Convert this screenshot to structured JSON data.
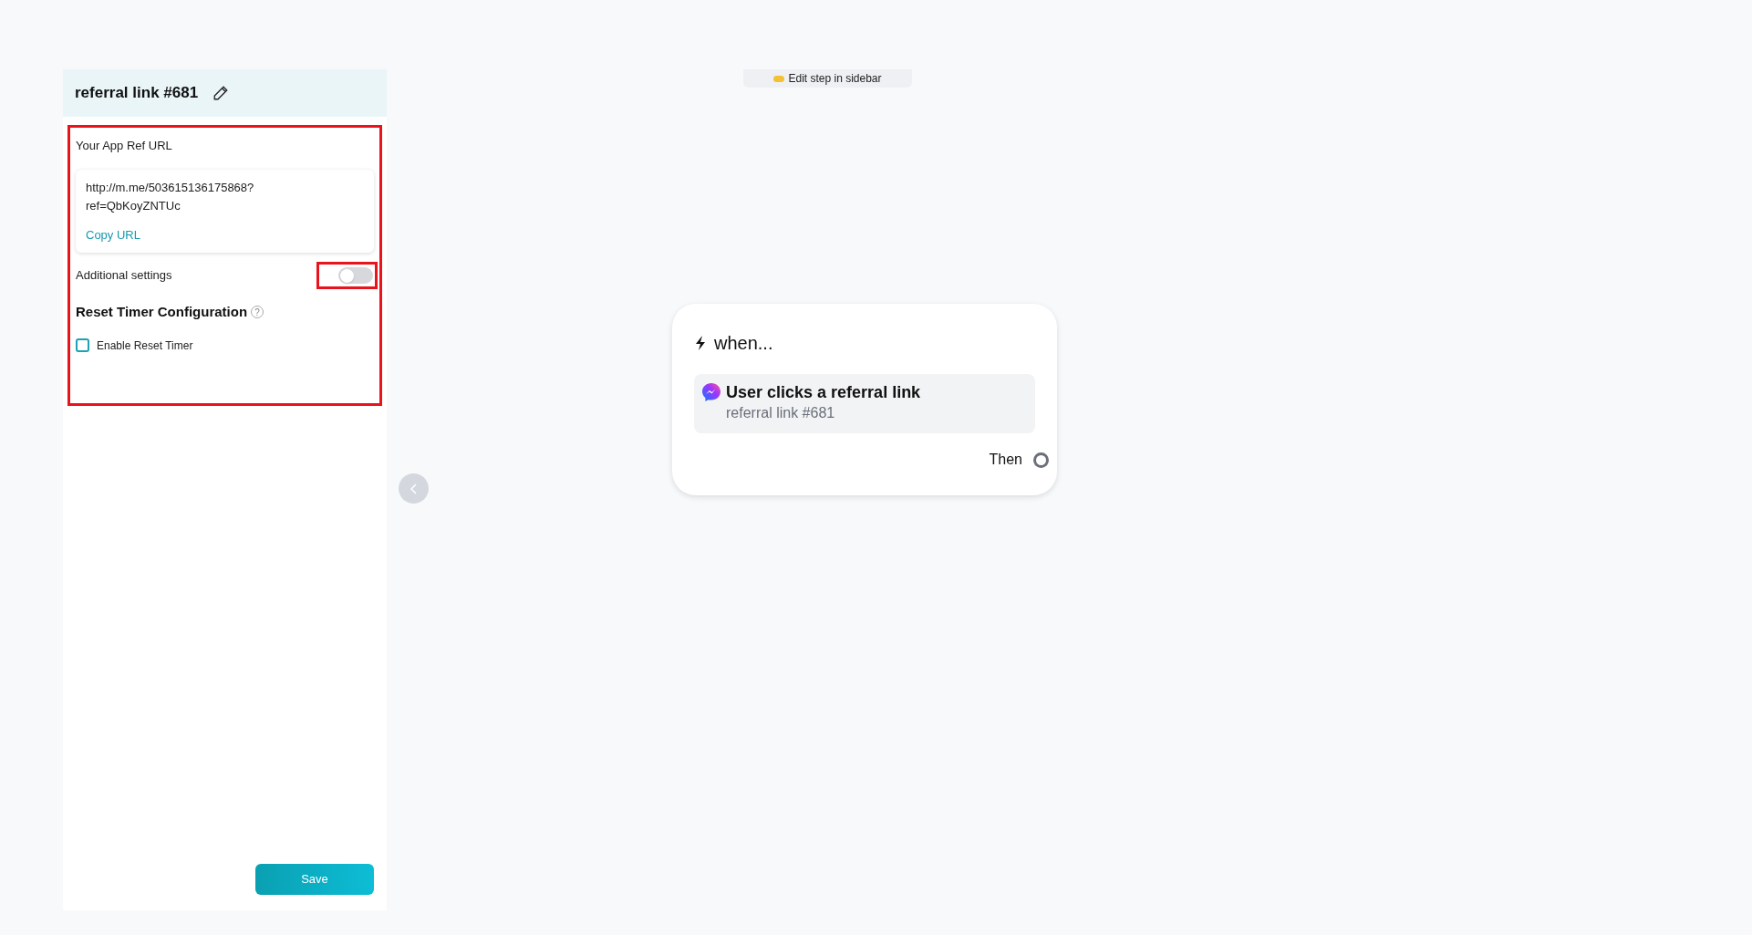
{
  "sidebar": {
    "title": "referral link #681",
    "ref_url": {
      "label": "Your App Ref URL",
      "lines": [
        "http://m.me/503615136175868?",
        "ref=QbKoyZNTUc"
      ],
      "copy": "Copy URL"
    },
    "additional_settings": {
      "label": "Additional settings",
      "on": false
    },
    "reset_timer": {
      "title": "Reset Timer Configuration",
      "help": "?",
      "checkbox": {
        "label": "Enable Reset Timer",
        "checked": false
      }
    },
    "save": "Save"
  },
  "canvas": {
    "hint": "Edit step in sidebar",
    "node": {
      "title": "when...",
      "trigger": {
        "title": "User clicks a referral link",
        "subtitle": "referral link #681"
      },
      "then": "Then"
    }
  }
}
